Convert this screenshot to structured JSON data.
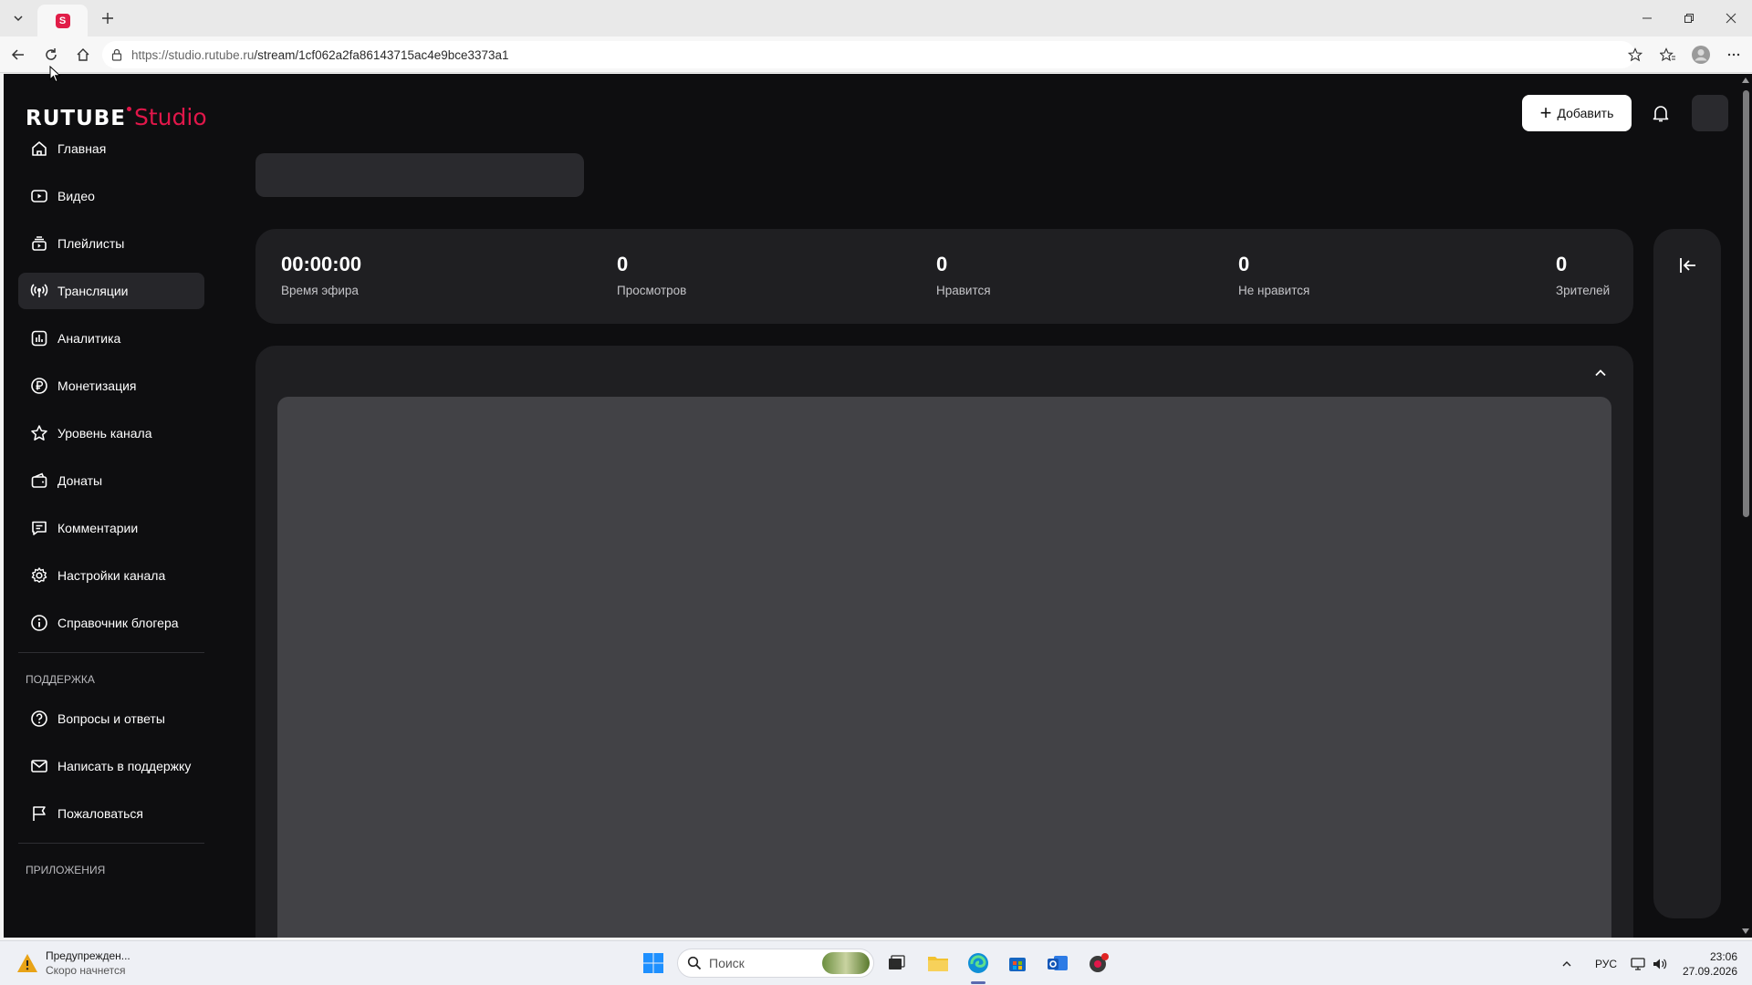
{
  "browser": {
    "url_host": "https://studio.rutube.ru",
    "url_path": "/stream/1cf062a2fa86143715ac4e9bce3373a1",
    "favicon_letter": "S"
  },
  "app": {
    "logo_main": "RUTUBE",
    "logo_studio": "Studio",
    "brand_color": "#e0174a",
    "add_button_label": "Добавить"
  },
  "sidebar": {
    "items": [
      {
        "label": "Главная",
        "icon": "home-icon"
      },
      {
        "label": "Видео",
        "icon": "video-icon"
      },
      {
        "label": "Плейлисты",
        "icon": "playlist-icon"
      },
      {
        "label": "Трансляции",
        "icon": "broadcast-icon",
        "active": true
      },
      {
        "label": "Аналитика",
        "icon": "analytics-icon"
      },
      {
        "label": "Монетизация",
        "icon": "ruble-icon"
      },
      {
        "label": "Уровень канала",
        "icon": "star-icon"
      },
      {
        "label": "Донаты",
        "icon": "wallet-icon"
      },
      {
        "label": "Комментарии",
        "icon": "comment-icon"
      },
      {
        "label": "Настройки канала",
        "icon": "gear-icon"
      },
      {
        "label": "Справочник блогера",
        "icon": "info-icon"
      }
    ],
    "support_label": "ПОДДЕРЖКА",
    "support_items": [
      {
        "label": "Вопросы и ответы",
        "icon": "question-icon"
      },
      {
        "label": "Написать в поддержку",
        "icon": "mail-icon"
      },
      {
        "label": "Пожаловаться",
        "icon": "flag-icon"
      }
    ],
    "apps_label": "ПРИЛОЖЕНИЯ"
  },
  "stats": [
    {
      "value": "00:00:00",
      "label": "Время эфира"
    },
    {
      "value": "0",
      "label": "Просмотров"
    },
    {
      "value": "0",
      "label": "Нравится"
    },
    {
      "value": "0",
      "label": "Не нравится"
    },
    {
      "value": "0",
      "label": "Зрителей"
    }
  ],
  "taskbar": {
    "notification_title": "Предупрежден...",
    "notification_sub": "Скоро начнется",
    "search_placeholder": "Поиск",
    "language": "РУС",
    "time": "23:06",
    "date": "27.09.2026"
  }
}
